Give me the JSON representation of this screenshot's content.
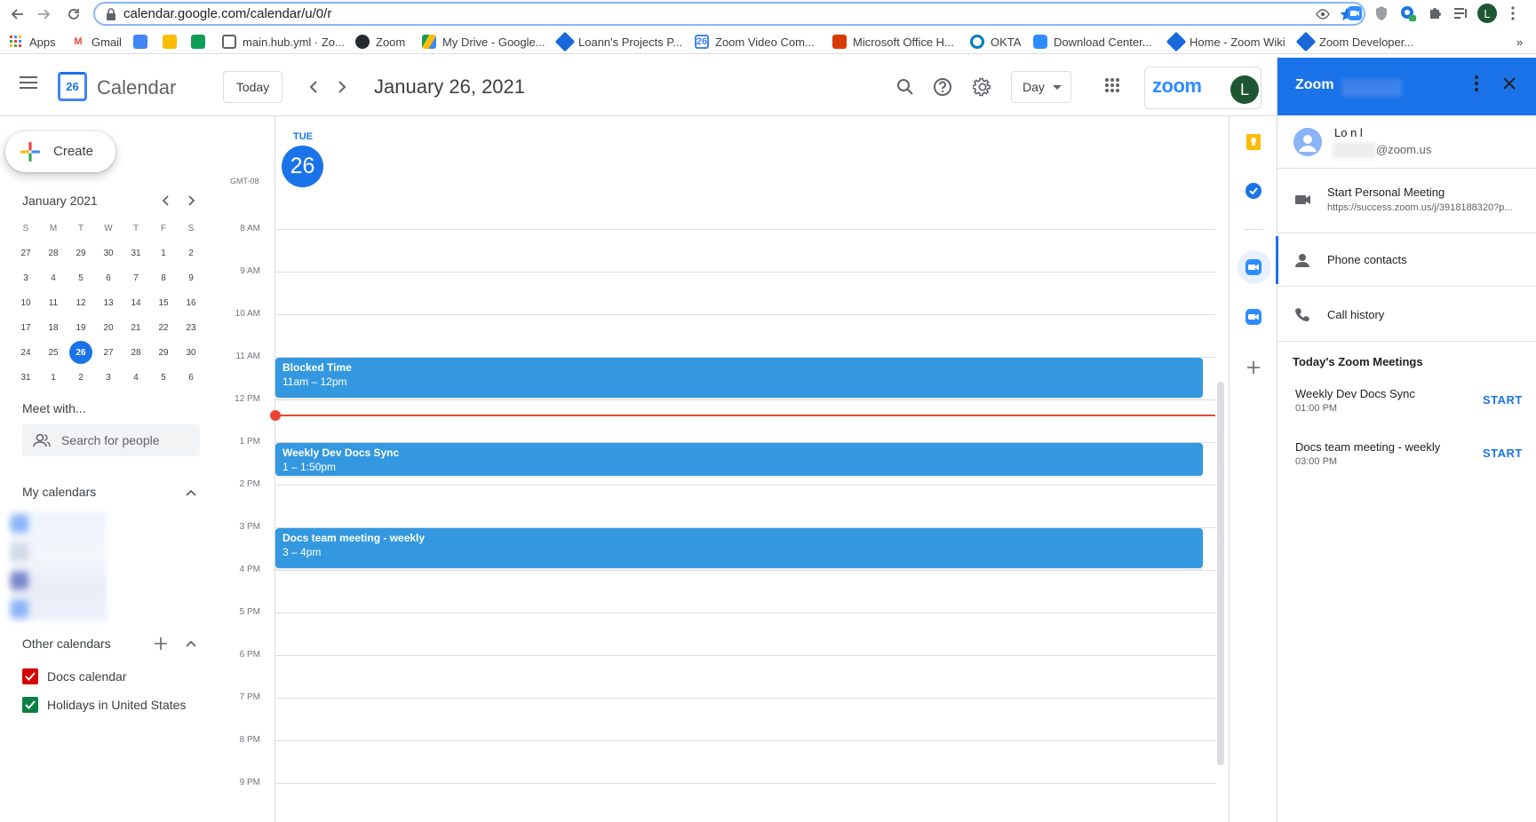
{
  "browser": {
    "url": "calendar.google.com/calendar/u/0/r",
    "profile_initial": "L",
    "bookmarks": [
      {
        "label": "Apps",
        "icon": "apps-grid-icon"
      },
      {
        "label": "Gmail",
        "icon": "gmail-icon"
      },
      {
        "label": "",
        "icon": "google-docs-icon"
      },
      {
        "label": "",
        "icon": "google-slides-icon"
      },
      {
        "label": "",
        "icon": "google-sheets-icon"
      },
      {
        "label": "main.hub.yml · Zo...",
        "icon": "hub-icon"
      },
      {
        "label": "Zoom",
        "icon": "github-icon"
      },
      {
        "label": "My Drive - Google...",
        "icon": "google-drive-icon"
      },
      {
        "label": "Loann's Projects P...",
        "icon": "confluence-icon"
      },
      {
        "label": "Zoom Video Com...",
        "icon": "google-calendar-icon"
      },
      {
        "label": "Microsoft Office H...",
        "icon": "office-icon"
      },
      {
        "label": "OKTA",
        "icon": "okta-icon"
      },
      {
        "label": "Download Center...",
        "icon": "zoom-icon"
      },
      {
        "label": "Home - Zoom Wiki",
        "icon": "confluence-icon"
      },
      {
        "label": "Zoom Developer...",
        "icon": "confluence-icon"
      }
    ],
    "more_bookmarks": "»"
  },
  "header": {
    "app_title": "Calendar",
    "logo_day": "26",
    "today_label": "Today",
    "date_title": "January 26, 2021",
    "view_label": "Day",
    "zoom_logo": "zoom",
    "avatar_initial": "L"
  },
  "sidebar": {
    "create_label": "Create",
    "mini_month": "January 2021",
    "dow": [
      "S",
      "M",
      "T",
      "W",
      "T",
      "F",
      "S"
    ],
    "weeks": [
      [
        "27",
        "28",
        "29",
        "30",
        "31",
        "1",
        "2"
      ],
      [
        "3",
        "4",
        "5",
        "6",
        "7",
        "8",
        "9"
      ],
      [
        "10",
        "11",
        "12",
        "13",
        "14",
        "15",
        "16"
      ],
      [
        "17",
        "18",
        "19",
        "20",
        "21",
        "22",
        "23"
      ],
      [
        "24",
        "25",
        "26",
        "27",
        "28",
        "29",
        "30"
      ],
      [
        "31",
        "1",
        "2",
        "3",
        "4",
        "5",
        "6"
      ]
    ],
    "selected_day": "26",
    "meet_with": "Meet with...",
    "search_placeholder": "Search for people",
    "my_calendars": "My calendars",
    "other_calendars": "Other calendars",
    "other_calendar_items": [
      {
        "label": "Docs calendar",
        "color": "#d50000"
      },
      {
        "label": "Holidays in United States",
        "color": "#0b8043"
      }
    ]
  },
  "day_view": {
    "dow": "TUE",
    "day": "26",
    "timezone": "GMT-08",
    "hours": [
      "8 AM",
      "9 AM",
      "10 AM",
      "11 AM",
      "12 PM",
      "1 PM",
      "2 PM",
      "3 PM",
      "4 PM",
      "5 PM",
      "6 PM",
      "7 PM",
      "8 PM",
      "9 PM"
    ],
    "events": [
      {
        "title": "Blocked Time",
        "time": "11am – 12pm"
      },
      {
        "title": "Weekly Dev Docs Sync",
        "time": "1 – 1:50pm"
      },
      {
        "title": "Docs team meeting - weekly",
        "time": "3 – 4pm"
      }
    ],
    "event_color": "#3498e0",
    "now_color": "#ea4335"
  },
  "zoom_panel": {
    "title": "Zoom",
    "user_name": "Lo    n l",
    "user_email": "@zoom.us",
    "start_personal": "Start Personal Meeting",
    "personal_link": "https://success.zoom.us/j/3918188320?p...",
    "phone_contacts": "Phone contacts",
    "call_history": "Call history",
    "todays_meetings_title": "Today's Zoom Meetings",
    "meetings": [
      {
        "name": "Weekly Dev Docs Sync",
        "time": "01:00 PM",
        "action": "START"
      },
      {
        "name": "Docs team meeting - weekly",
        "time": "03:00 PM",
        "action": "START"
      }
    ]
  }
}
